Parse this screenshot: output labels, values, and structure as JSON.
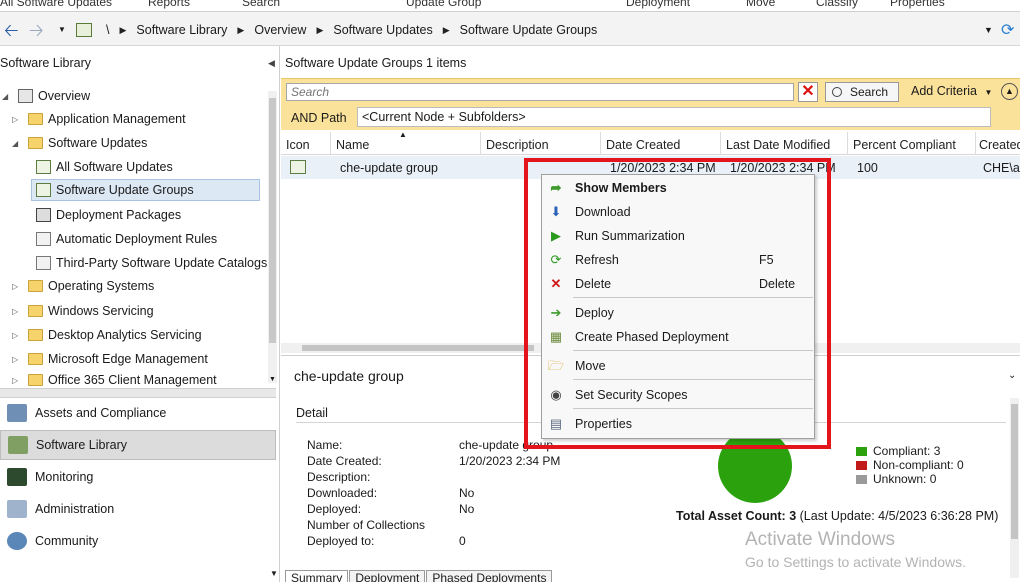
{
  "ribbon": [
    "All Software Updates",
    "Reports",
    "Search",
    "Update Group",
    "Deployment",
    "Move",
    "Classify",
    "Properties"
  ],
  "address": {
    "root": "\\",
    "crumbs": [
      "Software Library",
      "Overview",
      "Software Updates",
      "Software Update Groups"
    ]
  },
  "left": {
    "title": "Software Library",
    "tree": [
      {
        "label": "Overview"
      },
      {
        "label": "Application Management"
      },
      {
        "label": "Software Updates"
      },
      {
        "label": "All Software Updates"
      },
      {
        "label": "Software Update Groups"
      },
      {
        "label": "Deployment Packages"
      },
      {
        "label": "Automatic Deployment Rules"
      },
      {
        "label": "Third-Party Software Update Catalogs"
      },
      {
        "label": "Operating Systems"
      },
      {
        "label": "Windows Servicing"
      },
      {
        "label": "Desktop Analytics Servicing"
      },
      {
        "label": "Microsoft Edge Management"
      },
      {
        "label": "Office 365 Client Management"
      }
    ],
    "workspaces": [
      "Assets and Compliance",
      "Software Library",
      "Monitoring",
      "Administration",
      "Community"
    ]
  },
  "list": {
    "title": "Software Update Groups 1 items",
    "search_placeholder": "Search",
    "search_button": "Search",
    "add_criteria": "Add Criteria",
    "path_label": "AND Path",
    "path_value": "<Current Node + Subfolders>",
    "columns": [
      "Icon",
      "Name",
      "Description",
      "Date Created",
      "Last Date Modified",
      "Percent Compliant",
      "Created"
    ],
    "rows": [
      {
        "name": "che-update group",
        "date_created": "1/20/2023 2:34 PM",
        "last_modified": "1/20/2023 2:34 PM",
        "percent": "100",
        "created_by": "CHE\\ad"
      }
    ]
  },
  "detail": {
    "title": "che-update group",
    "section": "Detail",
    "fields": [
      {
        "k": "Name:",
        "v": "che-update group"
      },
      {
        "k": "Date Created:",
        "v": "1/20/2023 2:34 PM"
      },
      {
        "k": "Description:",
        "v": ""
      },
      {
        "k": "Downloaded:",
        "v": "No"
      },
      {
        "k": "Deployed:",
        "v": "No"
      },
      {
        "k": "Number of Collections",
        "v": ""
      },
      {
        "k": "Deployed to:",
        "v": "0"
      }
    ],
    "legend": [
      {
        "label": "Compliant: 3",
        "color": "#2ba20d"
      },
      {
        "label": "Non-compliant: 0",
        "color": "#c01a1a"
      },
      {
        "label": "Unknown: 0",
        "color": "#9a9a9a"
      }
    ],
    "total_label": "Total Asset Count: 3",
    "total_update": "(Last Update: 4/5/2023 6:36:28 PM)",
    "tabs": [
      "Summary",
      "Deployment",
      "Phased Deployments"
    ]
  },
  "watermark": {
    "line1": "Activate Windows",
    "line2": "Go to Settings to activate Windows."
  },
  "context_menu": {
    "items": [
      {
        "label": "Show Members",
        "icon": "arrow-right-icon",
        "bold": true
      },
      {
        "label": "Download",
        "icon": "download-icon"
      },
      {
        "label": "Run Summarization",
        "icon": "play-icon"
      },
      {
        "label": "Refresh",
        "icon": "refresh-icon",
        "shortcut": "F5"
      },
      {
        "label": "Delete",
        "icon": "delete-icon",
        "shortcut": "Delete"
      },
      {
        "label": "Deploy",
        "icon": "deploy-icon"
      },
      {
        "label": "Create Phased Deployment",
        "icon": "phased-icon"
      },
      {
        "label": "Move",
        "icon": "folder-move-icon"
      },
      {
        "label": "Set Security Scopes",
        "icon": "lock-icon"
      },
      {
        "label": "Properties",
        "icon": "properties-icon"
      }
    ]
  },
  "colors": {
    "accent_yellow": "#fbe29a",
    "highlight_red": "#e3141b",
    "compliant_green": "#2ba20d"
  }
}
